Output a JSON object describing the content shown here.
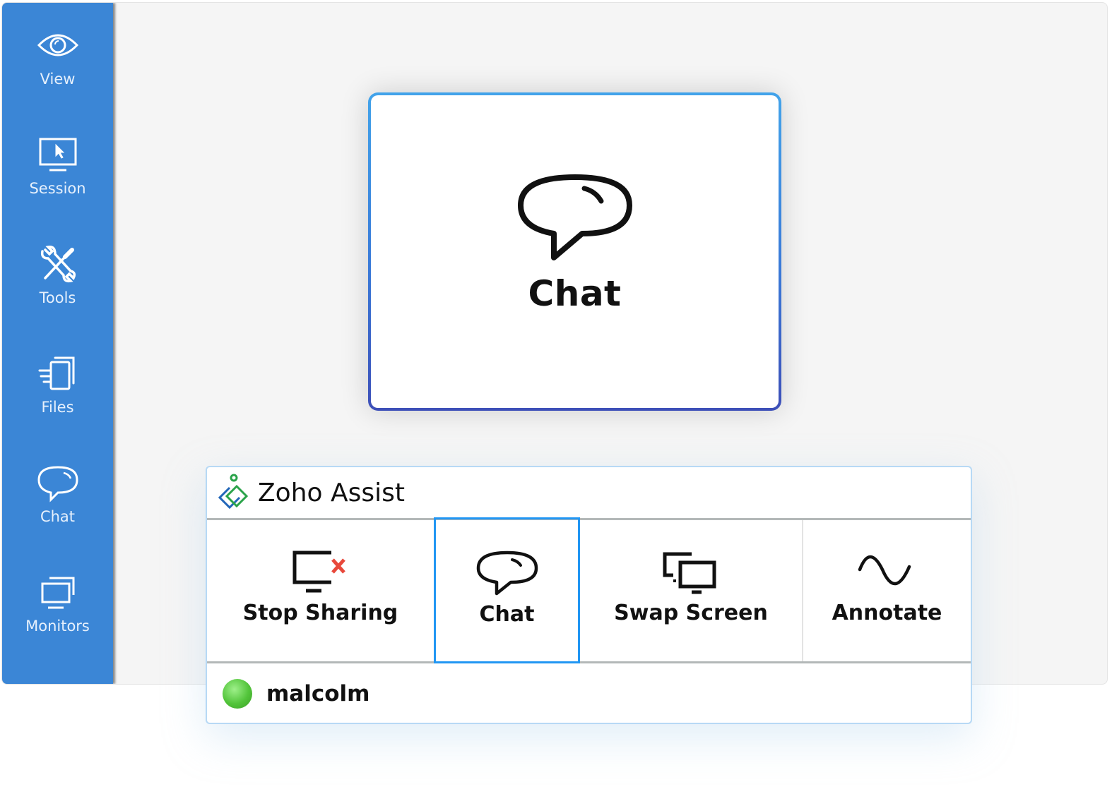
{
  "sidebar": {
    "items": [
      {
        "label": "View",
        "icon": "eye-icon"
      },
      {
        "label": "Session",
        "icon": "monitor-cursor-icon"
      },
      {
        "label": "Tools",
        "icon": "tools-icon"
      },
      {
        "label": "Files",
        "icon": "files-icon"
      },
      {
        "label": "Chat",
        "icon": "chat-bubble-icon"
      },
      {
        "label": "Monitors",
        "icon": "monitors-icon"
      }
    ],
    "color": "#3b86d6"
  },
  "popup": {
    "label": "Chat",
    "icon": "chat-bubble-icon"
  },
  "panel": {
    "brand": "Zoho Assist",
    "tools": [
      {
        "label": "Stop Sharing",
        "icon": "stop-sharing-icon"
      },
      {
        "label": "Chat",
        "icon": "chat-bubble-icon",
        "selected": true
      },
      {
        "label": "Swap Screen",
        "icon": "swap-screen-icon"
      },
      {
        "label": "Annotate",
        "icon": "annotate-wave-icon"
      }
    ],
    "user": {
      "name": "malcolm",
      "status": "online"
    },
    "selected_color": "#2196f3",
    "stop_color": "#e8483b"
  }
}
